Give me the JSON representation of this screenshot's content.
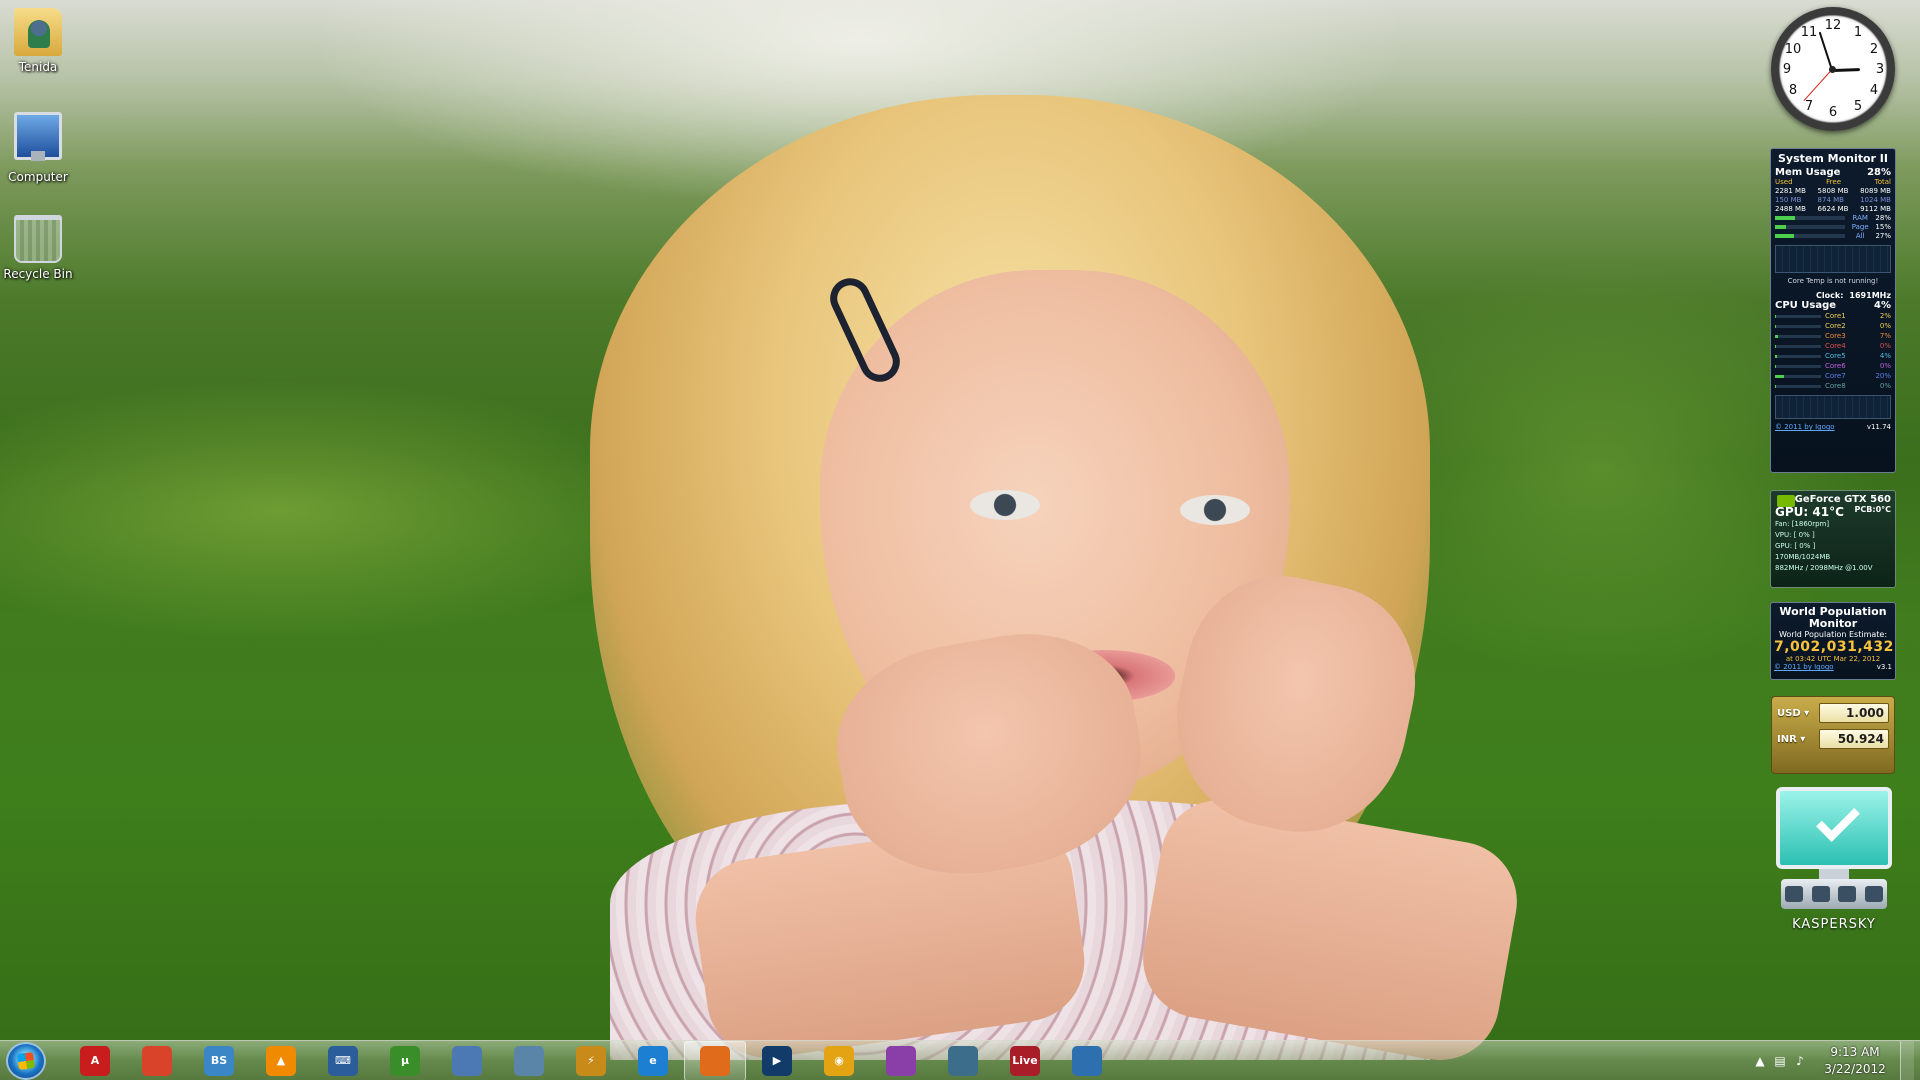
{
  "desktop": {
    "icons": [
      {
        "label": "Tenida",
        "icon": "user-folder-icon"
      },
      {
        "label": "Computer",
        "icon": "computer-icon"
      },
      {
        "label": "Recycle Bin",
        "icon": "recycle-bin-icon"
      }
    ]
  },
  "clock_gadget": {
    "numbers": [
      "12",
      "1",
      "2",
      "3",
      "4",
      "5",
      "6",
      "7",
      "8",
      "9",
      "10",
      "11"
    ]
  },
  "system_monitor": {
    "title": "System Monitor II",
    "mem_label": "Mem Usage",
    "mem_percent": "28%",
    "mem_cols": [
      "Used",
      "Free",
      "Total"
    ],
    "mem_rows": [
      [
        "2281 MB",
        "5808 MB",
        "8089 MB"
      ],
      [
        "150 MB",
        "874 MB",
        "1024 MB"
      ],
      [
        "2488 MB",
        "6624 MB",
        "9112 MB"
      ]
    ],
    "bars": [
      {
        "label": "RAM",
        "value": "28%",
        "fill": 0.28
      },
      {
        "label": "Page",
        "value": "15%",
        "fill": 0.15
      },
      {
        "label": "All",
        "value": "27%",
        "fill": 0.27
      }
    ],
    "core_temp_msg": "Core Temp is not running!",
    "clock_label": "Clock:",
    "clock_value": "1691MHz",
    "cpu_label": "CPU Usage",
    "cpu_percent": "4%",
    "cores": [
      {
        "name": "Core1",
        "value": "2%",
        "fill": 0.02
      },
      {
        "name": "Core2",
        "value": "0%",
        "fill": 0.0
      },
      {
        "name": "Core3",
        "value": "7%",
        "fill": 0.07
      },
      {
        "name": "Core4",
        "value": "0%",
        "fill": 0.0
      },
      {
        "name": "Core5",
        "value": "4%",
        "fill": 0.04
      },
      {
        "name": "Core6",
        "value": "0%",
        "fill": 0.0
      },
      {
        "name": "Core7",
        "value": "20%",
        "fill": 0.2
      },
      {
        "name": "Core8",
        "value": "0%",
        "fill": 0.0
      }
    ],
    "footer_link": "© 2011 by Igogo",
    "version": "v11.74"
  },
  "gpu_gadget": {
    "title": "GeForce GTX 560",
    "gpu_label": "GPU:",
    "gpu_temp": "41°C",
    "pcb": "PCB:0°C",
    "fan": "Fan: [1860rpm]",
    "vpu": "VPU: [ 0% ]",
    "gpu_load": "GPU: [ 0% ]",
    "mem": "170MB/1024MB",
    "clocks": "882MHz / 2098MHz @1.00V"
  },
  "world_population": {
    "title_line1": "World Population",
    "title_line2": "Monitor",
    "subtitle": "World Population Estimate:",
    "value": "7,002,031,432",
    "at": "at 03:42 UTC Mar 22, 2012",
    "footer_link": "© 2011 by Igogo",
    "version": "v3.1"
  },
  "currency": {
    "rows": [
      {
        "code": "USD",
        "value": "1.000"
      },
      {
        "code": "INR",
        "value": "50.924"
      }
    ]
  },
  "kaspersky": {
    "brand": "KASPERSKY"
  },
  "taskbar": {
    "pinned": [
      {
        "name": "acrobat-icon",
        "glyph": "A",
        "color": "#c91c1c"
      },
      {
        "name": "pdf-tool-icon",
        "glyph": "",
        "color": "#d8432a"
      },
      {
        "name": "media-server-icon",
        "glyph": "BS",
        "color": "#3a86c6"
      },
      {
        "name": "vlc-icon",
        "glyph": "▲",
        "color": "#f08a00"
      },
      {
        "name": "keyboard-app-icon",
        "glyph": "⌨",
        "color": "#2a5d9a"
      },
      {
        "name": "utorrent-icon",
        "glyph": "µ",
        "color": "#3a8e2a"
      },
      {
        "name": "network-icon",
        "glyph": "",
        "color": "#4c79b4"
      },
      {
        "name": "calculator-icon",
        "glyph": "",
        "color": "#5a84a8"
      },
      {
        "name": "winamp-icon",
        "glyph": "⚡",
        "color": "#c88b1a"
      },
      {
        "name": "internet-explorer-icon",
        "glyph": "e",
        "color": "#1c7fd1"
      },
      {
        "name": "firefox-icon",
        "glyph": "",
        "color": "#e06b1a"
      },
      {
        "name": "media-player-icon",
        "glyph": "▶",
        "color": "#123b6a"
      },
      {
        "name": "music-player-icon",
        "glyph": "◉",
        "color": "#e3a313"
      },
      {
        "name": "picasa-icon",
        "glyph": "",
        "color": "#8a3fa8"
      },
      {
        "name": "remote-desktop-icon",
        "glyph": "",
        "color": "#3c6e8c"
      },
      {
        "name": "windows-live-icon",
        "glyph": "Live",
        "color": "#a81d28"
      },
      {
        "name": "app-icon",
        "glyph": "",
        "color": "#2e6fb0"
      }
    ],
    "active_index": 10,
    "time": "9:13 AM",
    "date": "3/22/2012"
  }
}
